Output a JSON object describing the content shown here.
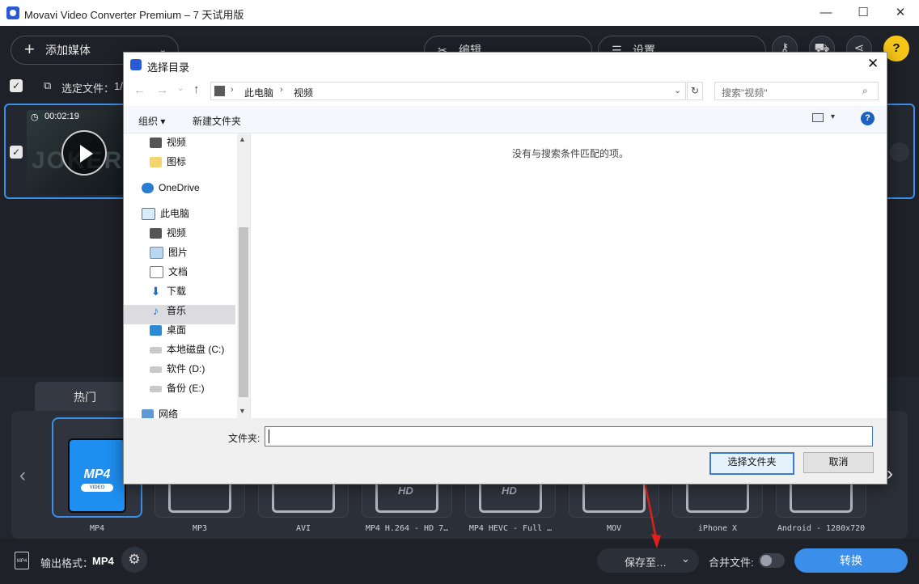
{
  "app": {
    "title": "Movavi Video Converter Premium – 7 天试用版",
    "window_controls": [
      "—",
      "☐",
      "✕"
    ]
  },
  "toolbar": {
    "add_media": "添加媒体",
    "edit": "编辑",
    "settings": "设置"
  },
  "files_bar": {
    "selected_label": "选定文件：",
    "selected_count": "1/"
  },
  "file_item": {
    "duration": "00:02:19",
    "thumb_text": "JOKER"
  },
  "formats": {
    "tab_hot": "热门",
    "items": [
      {
        "label": "MP4",
        "badge": "MP4",
        "badge_sub": "VIDEO"
      },
      {
        "label": "MP3"
      },
      {
        "label": "AVI"
      },
      {
        "label": "MP4 H.264 - HD 7…",
        "badge": "HD"
      },
      {
        "label": "MP4 HEVC - Full …",
        "badge": "HD"
      },
      {
        "label": "MOV"
      },
      {
        "label": "iPhone X"
      },
      {
        "label": "Android - 1280x720"
      }
    ]
  },
  "bottom": {
    "output_format_label": "输出格式：",
    "output_format_value": "MP4",
    "save_to": "保存至…",
    "merge_files": "合并文件:",
    "convert": "转换"
  },
  "dialog": {
    "title": "选择目录",
    "breadcrumb": [
      "此电脑",
      "视频"
    ],
    "search_placeholder": "搜索\"视频\"",
    "cmd_organize": "组织",
    "cmd_new_folder": "新建文件夹",
    "nav": {
      "video_top": "视频",
      "icons_folder": "图标",
      "onedrive": "OneDrive",
      "this_pc": "此电脑",
      "video": "视频",
      "pictures": "图片",
      "documents": "文档",
      "downloads": "下载",
      "music": "音乐",
      "desktop": "桌面",
      "disk_c": "本地磁盘 (C:)",
      "disk_d": "软件 (D:)",
      "disk_e": "备份 (E:)",
      "network": "网络"
    },
    "empty_message": "没有与搜索条件匹配的项。",
    "folder_label": "文件夹:",
    "folder_value": "",
    "select_button": "选择文件夹",
    "cancel_button": "取消"
  },
  "colors": {
    "accent": "#3b8eea",
    "mp4_tile": "#1e8ef0",
    "annotation_arrow": "#e0201a",
    "help": "#f5c518"
  }
}
